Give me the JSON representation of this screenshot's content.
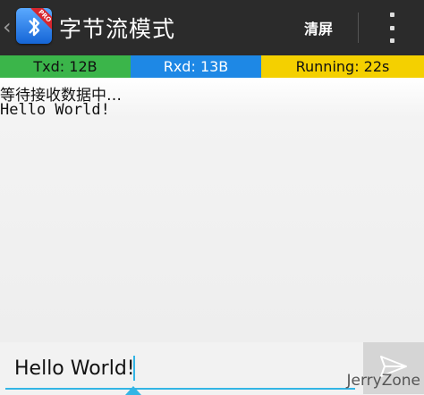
{
  "actionbar": {
    "title": "字节流模式",
    "clear_label": "清屏",
    "app_icon_badge": "PRO",
    "icons": [
      "chevron-left-icon",
      "bluetooth-app-icon",
      "overflow-menu-icon"
    ]
  },
  "status": {
    "txd": "Txd: 12B",
    "rxd": "Rxd: 13B",
    "running": "Running: 22s",
    "colors": {
      "txd": "#3bb54a",
      "rxd": "#1e88e5",
      "running": "#f4d000"
    }
  },
  "receive": {
    "status_text": "等待接收数据中…",
    "data": "Hello World!"
  },
  "input": {
    "value": "Hello World!"
  },
  "send": {
    "icon": "send-icon"
  },
  "watermark": "JerryZone"
}
